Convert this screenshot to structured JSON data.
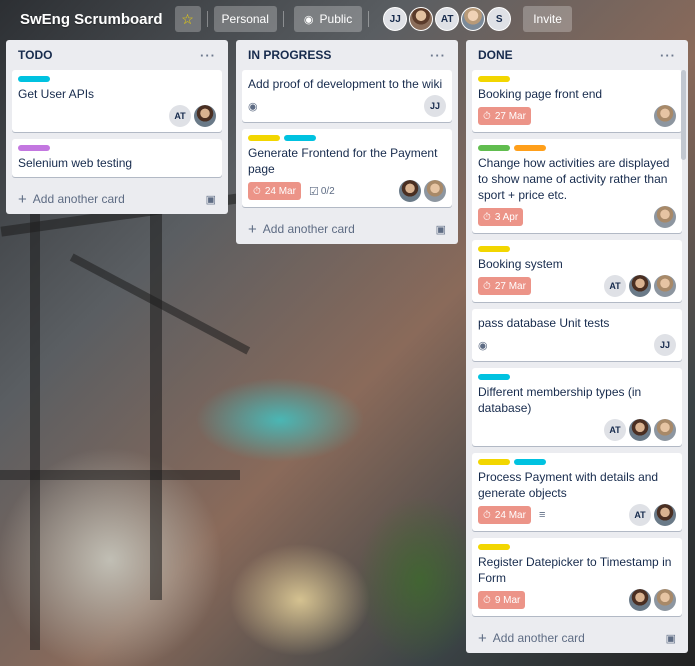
{
  "board": {
    "title": "SwEng Scrumboard",
    "personal_label": "Personal",
    "public_label": "Public",
    "invite_label": "Invite",
    "members": [
      {
        "initials": "JJ",
        "photo": false
      },
      {
        "initials": "",
        "photo": true
      },
      {
        "initials": "AT",
        "photo": false
      },
      {
        "initials": "",
        "photo": true
      },
      {
        "initials": "S",
        "photo": false
      }
    ]
  },
  "colors": {
    "cyan": "#00c2e0",
    "purple": "#c377e0",
    "yellow": "#f2d600",
    "green": "#61bd4f",
    "orange": "#ff9f1a",
    "due_bg": "#ec9488"
  },
  "add_card_label": "Add another card",
  "lists": [
    {
      "name": "TODO",
      "cards": [
        {
          "title": "Get User APIs",
          "labels": [
            "cyan"
          ],
          "members": [
            "AT",
            "photo"
          ]
        },
        {
          "title": "Selenium web testing",
          "labels": [
            "purple"
          ],
          "members": []
        }
      ]
    },
    {
      "name": "IN PROGRESS",
      "cards": [
        {
          "title": "Add proof of development to the wiki",
          "labels": [],
          "watch": true,
          "members": [
            "JJ"
          ]
        },
        {
          "title": "Generate Frontend for the Payment page",
          "labels": [
            "yellow",
            "cyan"
          ],
          "due": "24 Mar",
          "checklist": "0/2",
          "members": [
            "photo",
            "photo2"
          ]
        }
      ]
    },
    {
      "name": "DONE",
      "cards": [
        {
          "title": "Booking page front end",
          "labels": [
            "yellow"
          ],
          "due": "27 Mar",
          "members": [
            "photo2"
          ]
        },
        {
          "title": "Change how activities are displayed to show name of activity rather than sport + price etc.",
          "labels": [
            "green",
            "orange"
          ],
          "due": "3 Apr",
          "members": [
            "photo2"
          ]
        },
        {
          "title": "Booking system",
          "labels": [
            "yellow"
          ],
          "due": "27 Mar",
          "members": [
            "AT",
            "photo",
            "photo2"
          ]
        },
        {
          "title": "pass database Unit tests",
          "labels": [],
          "watch": true,
          "members": [
            "JJ"
          ]
        },
        {
          "title": "Different membership types (in database)",
          "labels": [
            "cyan"
          ],
          "members": [
            "AT",
            "photo",
            "photo2"
          ]
        },
        {
          "title": "Process Payment with details and generate objects",
          "labels": [
            "yellow",
            "cyan"
          ],
          "due": "24 Mar",
          "description": true,
          "members": [
            "AT",
            "photo"
          ]
        },
        {
          "title": "Register Datepicker to Timestamp in Form",
          "labels": [
            "yellow"
          ],
          "due": "9 Mar",
          "members": [
            "photo",
            "photo2"
          ]
        }
      ]
    }
  ]
}
